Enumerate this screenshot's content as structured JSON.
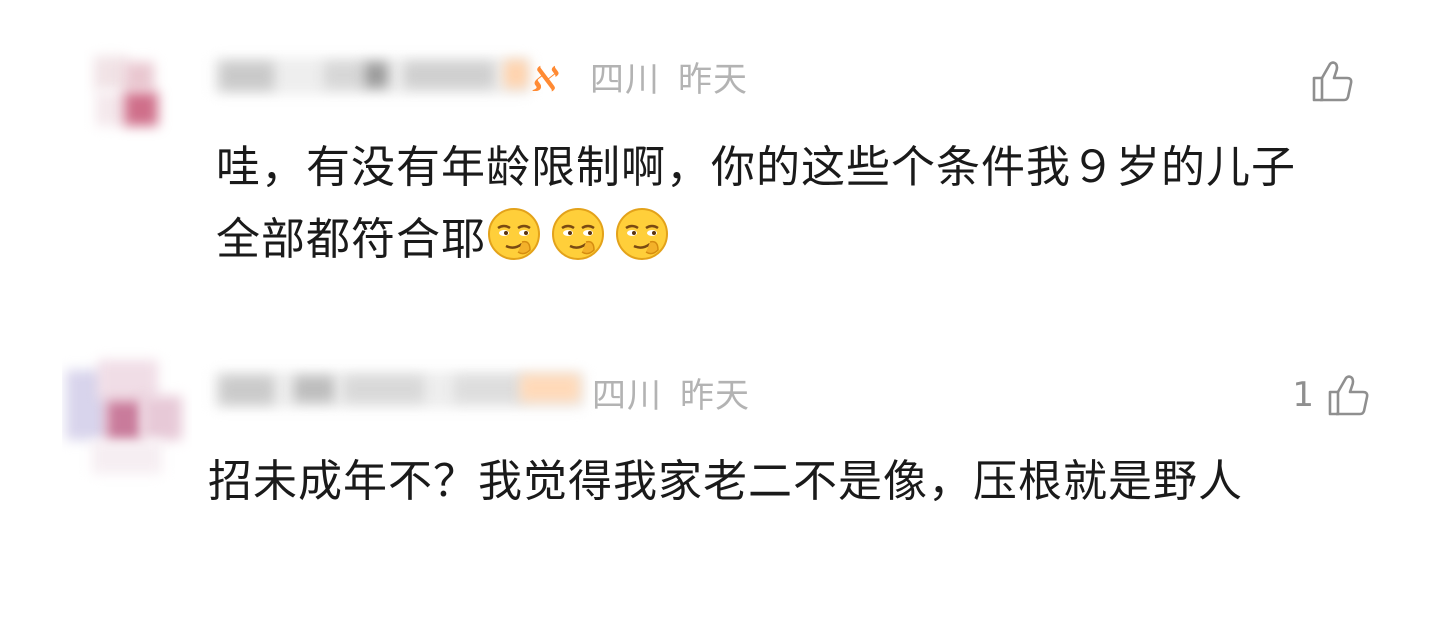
{
  "comments": [
    {
      "location": "四川",
      "time": "昨天",
      "likes": "",
      "text": "哇，有没有年龄限制啊，你的这些个条件我９岁的儿子全部都符合耶",
      "emoji": [
        "smirk-emoji",
        "smirk-emoji",
        "smirk-emoji"
      ]
    },
    {
      "location": "四川",
      "time": "昨天",
      "likes": "1",
      "text": "招未成年不？我觉得我家老二不是像，压根就是野人",
      "emoji": []
    }
  ],
  "colors": {
    "meta_gray": "#b3b3b3",
    "text_dark": "#1a1a1a",
    "vip_orange": "#ff8a33"
  }
}
